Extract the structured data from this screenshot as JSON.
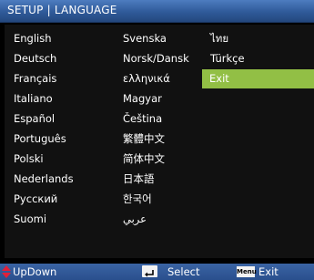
{
  "title": "SETUP | LANGUAGE",
  "languages": [
    [
      "English",
      "Svenska",
      "ไทย"
    ],
    [
      "Deutsch",
      "Norsk/Dansk",
      "Türkçe"
    ],
    [
      "Français",
      "ελληνικά",
      "Exit"
    ],
    [
      "Italiano",
      "Magyar",
      ""
    ],
    [
      "Español",
      "Čeština",
      ""
    ],
    [
      "Português",
      "繁體中文",
      ""
    ],
    [
      "Polski",
      "简体中文",
      ""
    ],
    [
      "Nederlands",
      "日本語",
      ""
    ],
    [
      "Русский",
      "한국어",
      ""
    ],
    [
      "Suomi",
      "عربي",
      ""
    ]
  ],
  "selected": "Exit",
  "colors": {
    "title_bar": "#2f5a99",
    "highlight": "#92bf45",
    "background": "#000000",
    "footer": "#2f5a99"
  },
  "footer": {
    "updown_label": "UpDown",
    "select_label": "Select",
    "exit_label": "Exit",
    "menu_key": "Menu",
    "icons": [
      "updown-icon",
      "enter-icon",
      "menu-key-icon"
    ]
  }
}
